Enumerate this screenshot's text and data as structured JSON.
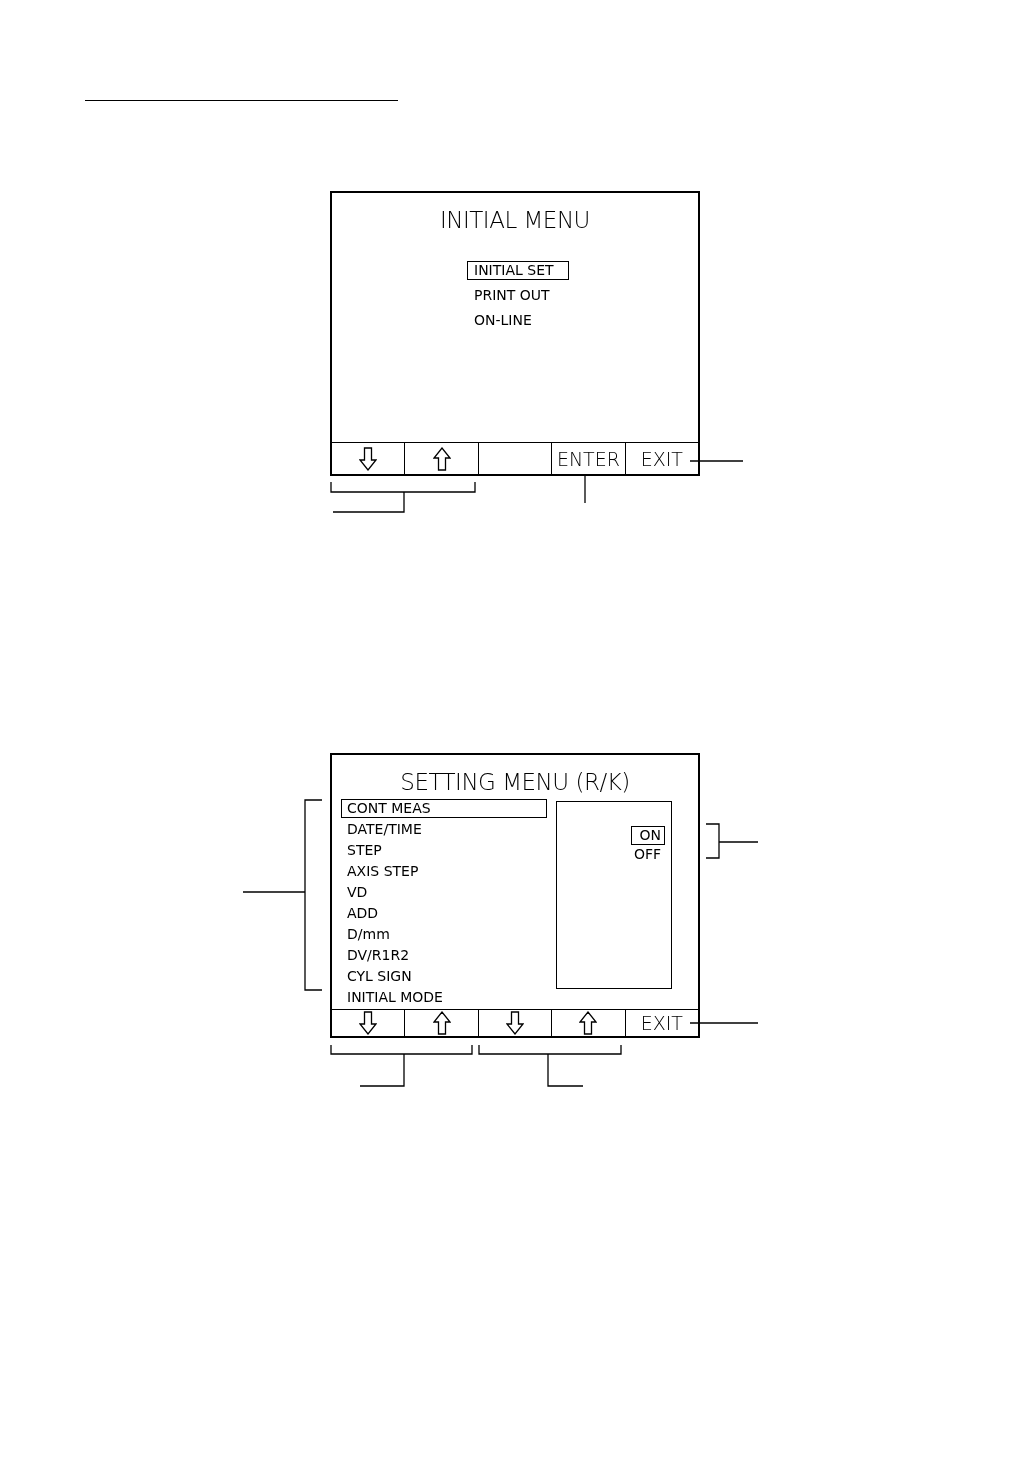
{
  "screens": [
    {
      "kind": "menu",
      "title": "INITIAL MENU",
      "items": [
        {
          "label": "INITIAL SET",
          "selected": true
        },
        {
          "label": "PRINT OUT",
          "selected": false
        },
        {
          "label": "ON-LINE",
          "selected": false
        }
      ],
      "keys": [
        {
          "kind": "down"
        },
        {
          "kind": "up"
        },
        {
          "kind": "blank"
        },
        {
          "kind": "text",
          "label": "ENTER"
        },
        {
          "kind": "text",
          "label": "EXIT"
        }
      ]
    },
    {
      "kind": "setting",
      "title": "SETTING MENU (R/K)",
      "items": [
        {
          "label": "CONT MEAS",
          "selected": true
        },
        {
          "label": "DATE/TIME",
          "selected": false
        },
        {
          "label": "STEP",
          "selected": false
        },
        {
          "label": "AXIS STEP",
          "selected": false
        },
        {
          "label": "VD",
          "selected": false
        },
        {
          "label": "ADD",
          "selected": false
        },
        {
          "label": "D/mm",
          "selected": false
        },
        {
          "label": "DV/R1R2",
          "selected": false
        },
        {
          "label": "CYL SIGN",
          "selected": false
        },
        {
          "label": "INITIAL MODE",
          "selected": false
        }
      ],
      "options": [
        {
          "label": "ON",
          "selected": true
        },
        {
          "label": "OFF",
          "selected": false
        }
      ],
      "keys": [
        {
          "kind": "down"
        },
        {
          "kind": "up"
        },
        {
          "kind": "down"
        },
        {
          "kind": "up"
        },
        {
          "kind": "text",
          "label": "EXIT"
        }
      ]
    }
  ]
}
